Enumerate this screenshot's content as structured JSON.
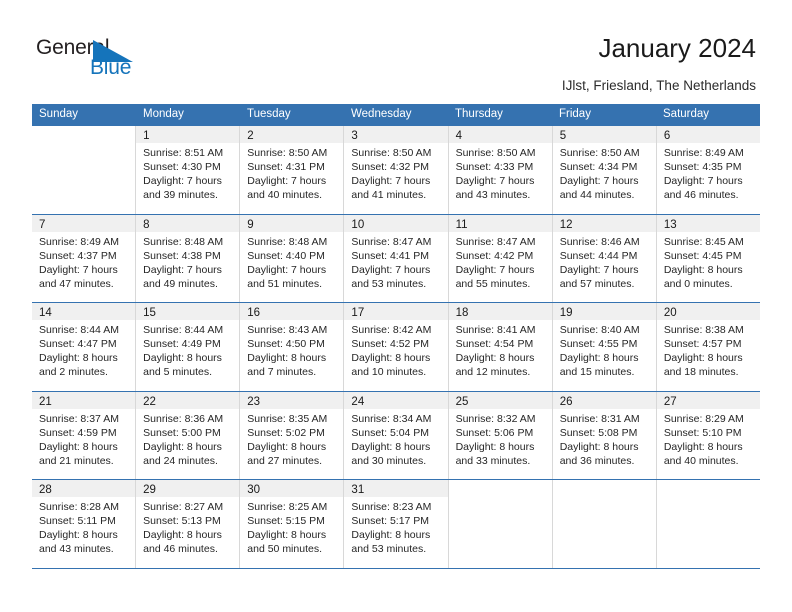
{
  "brand": {
    "name_part1": "General",
    "name_part2": "Blue",
    "accent_color": "#1574bb"
  },
  "header": {
    "title": "January 2024",
    "subtitle": "IJlst, Friesland, The Netherlands"
  },
  "calendar": {
    "header_bg": "#3572b0",
    "weekdays": [
      "Sunday",
      "Monday",
      "Tuesday",
      "Wednesday",
      "Thursday",
      "Friday",
      "Saturday"
    ],
    "weeks": [
      [
        {
          "day": "",
          "sunrise": "",
          "sunset": "",
          "daylight_line1": "",
          "daylight_line2": ""
        },
        {
          "day": "1",
          "sunrise": "Sunrise: 8:51 AM",
          "sunset": "Sunset: 4:30 PM",
          "daylight_line1": "Daylight: 7 hours",
          "daylight_line2": "and 39 minutes."
        },
        {
          "day": "2",
          "sunrise": "Sunrise: 8:50 AM",
          "sunset": "Sunset: 4:31 PM",
          "daylight_line1": "Daylight: 7 hours",
          "daylight_line2": "and 40 minutes."
        },
        {
          "day": "3",
          "sunrise": "Sunrise: 8:50 AM",
          "sunset": "Sunset: 4:32 PM",
          "daylight_line1": "Daylight: 7 hours",
          "daylight_line2": "and 41 minutes."
        },
        {
          "day": "4",
          "sunrise": "Sunrise: 8:50 AM",
          "sunset": "Sunset: 4:33 PM",
          "daylight_line1": "Daylight: 7 hours",
          "daylight_line2": "and 43 minutes."
        },
        {
          "day": "5",
          "sunrise": "Sunrise: 8:50 AM",
          "sunset": "Sunset: 4:34 PM",
          "daylight_line1": "Daylight: 7 hours",
          "daylight_line2": "and 44 minutes."
        },
        {
          "day": "6",
          "sunrise": "Sunrise: 8:49 AM",
          "sunset": "Sunset: 4:35 PM",
          "daylight_line1": "Daylight: 7 hours",
          "daylight_line2": "and 46 minutes."
        }
      ],
      [
        {
          "day": "7",
          "sunrise": "Sunrise: 8:49 AM",
          "sunset": "Sunset: 4:37 PM",
          "daylight_line1": "Daylight: 7 hours",
          "daylight_line2": "and 47 minutes."
        },
        {
          "day": "8",
          "sunrise": "Sunrise: 8:48 AM",
          "sunset": "Sunset: 4:38 PM",
          "daylight_line1": "Daylight: 7 hours",
          "daylight_line2": "and 49 minutes."
        },
        {
          "day": "9",
          "sunrise": "Sunrise: 8:48 AM",
          "sunset": "Sunset: 4:40 PM",
          "daylight_line1": "Daylight: 7 hours",
          "daylight_line2": "and 51 minutes."
        },
        {
          "day": "10",
          "sunrise": "Sunrise: 8:47 AM",
          "sunset": "Sunset: 4:41 PM",
          "daylight_line1": "Daylight: 7 hours",
          "daylight_line2": "and 53 minutes."
        },
        {
          "day": "11",
          "sunrise": "Sunrise: 8:47 AM",
          "sunset": "Sunset: 4:42 PM",
          "daylight_line1": "Daylight: 7 hours",
          "daylight_line2": "and 55 minutes."
        },
        {
          "day": "12",
          "sunrise": "Sunrise: 8:46 AM",
          "sunset": "Sunset: 4:44 PM",
          "daylight_line1": "Daylight: 7 hours",
          "daylight_line2": "and 57 minutes."
        },
        {
          "day": "13",
          "sunrise": "Sunrise: 8:45 AM",
          "sunset": "Sunset: 4:45 PM",
          "daylight_line1": "Daylight: 8 hours",
          "daylight_line2": "and 0 minutes."
        }
      ],
      [
        {
          "day": "14",
          "sunrise": "Sunrise: 8:44 AM",
          "sunset": "Sunset: 4:47 PM",
          "daylight_line1": "Daylight: 8 hours",
          "daylight_line2": "and 2 minutes."
        },
        {
          "day": "15",
          "sunrise": "Sunrise: 8:44 AM",
          "sunset": "Sunset: 4:49 PM",
          "daylight_line1": "Daylight: 8 hours",
          "daylight_line2": "and 5 minutes."
        },
        {
          "day": "16",
          "sunrise": "Sunrise: 8:43 AM",
          "sunset": "Sunset: 4:50 PM",
          "daylight_line1": "Daylight: 8 hours",
          "daylight_line2": "and 7 minutes."
        },
        {
          "day": "17",
          "sunrise": "Sunrise: 8:42 AM",
          "sunset": "Sunset: 4:52 PM",
          "daylight_line1": "Daylight: 8 hours",
          "daylight_line2": "and 10 minutes."
        },
        {
          "day": "18",
          "sunrise": "Sunrise: 8:41 AM",
          "sunset": "Sunset: 4:54 PM",
          "daylight_line1": "Daylight: 8 hours",
          "daylight_line2": "and 12 minutes."
        },
        {
          "day": "19",
          "sunrise": "Sunrise: 8:40 AM",
          "sunset": "Sunset: 4:55 PM",
          "daylight_line1": "Daylight: 8 hours",
          "daylight_line2": "and 15 minutes."
        },
        {
          "day": "20",
          "sunrise": "Sunrise: 8:38 AM",
          "sunset": "Sunset: 4:57 PM",
          "daylight_line1": "Daylight: 8 hours",
          "daylight_line2": "and 18 minutes."
        }
      ],
      [
        {
          "day": "21",
          "sunrise": "Sunrise: 8:37 AM",
          "sunset": "Sunset: 4:59 PM",
          "daylight_line1": "Daylight: 8 hours",
          "daylight_line2": "and 21 minutes."
        },
        {
          "day": "22",
          "sunrise": "Sunrise: 8:36 AM",
          "sunset": "Sunset: 5:00 PM",
          "daylight_line1": "Daylight: 8 hours",
          "daylight_line2": "and 24 minutes."
        },
        {
          "day": "23",
          "sunrise": "Sunrise: 8:35 AM",
          "sunset": "Sunset: 5:02 PM",
          "daylight_line1": "Daylight: 8 hours",
          "daylight_line2": "and 27 minutes."
        },
        {
          "day": "24",
          "sunrise": "Sunrise: 8:34 AM",
          "sunset": "Sunset: 5:04 PM",
          "daylight_line1": "Daylight: 8 hours",
          "daylight_line2": "and 30 minutes."
        },
        {
          "day": "25",
          "sunrise": "Sunrise: 8:32 AM",
          "sunset": "Sunset: 5:06 PM",
          "daylight_line1": "Daylight: 8 hours",
          "daylight_line2": "and 33 minutes."
        },
        {
          "day": "26",
          "sunrise": "Sunrise: 8:31 AM",
          "sunset": "Sunset: 5:08 PM",
          "daylight_line1": "Daylight: 8 hours",
          "daylight_line2": "and 36 minutes."
        },
        {
          "day": "27",
          "sunrise": "Sunrise: 8:29 AM",
          "sunset": "Sunset: 5:10 PM",
          "daylight_line1": "Daylight: 8 hours",
          "daylight_line2": "and 40 minutes."
        }
      ],
      [
        {
          "day": "28",
          "sunrise": "Sunrise: 8:28 AM",
          "sunset": "Sunset: 5:11 PM",
          "daylight_line1": "Daylight: 8 hours",
          "daylight_line2": "and 43 minutes."
        },
        {
          "day": "29",
          "sunrise": "Sunrise: 8:27 AM",
          "sunset": "Sunset: 5:13 PM",
          "daylight_line1": "Daylight: 8 hours",
          "daylight_line2": "and 46 minutes."
        },
        {
          "day": "30",
          "sunrise": "Sunrise: 8:25 AM",
          "sunset": "Sunset: 5:15 PM",
          "daylight_line1": "Daylight: 8 hours",
          "daylight_line2": "and 50 minutes."
        },
        {
          "day": "31",
          "sunrise": "Sunrise: 8:23 AM",
          "sunset": "Sunset: 5:17 PM",
          "daylight_line1": "Daylight: 8 hours",
          "daylight_line2": "and 53 minutes."
        },
        {
          "day": "",
          "sunrise": "",
          "sunset": "",
          "daylight_line1": "",
          "daylight_line2": ""
        },
        {
          "day": "",
          "sunrise": "",
          "sunset": "",
          "daylight_line1": "",
          "daylight_line2": ""
        },
        {
          "day": "",
          "sunrise": "",
          "sunset": "",
          "daylight_line1": "",
          "daylight_line2": ""
        }
      ]
    ]
  }
}
